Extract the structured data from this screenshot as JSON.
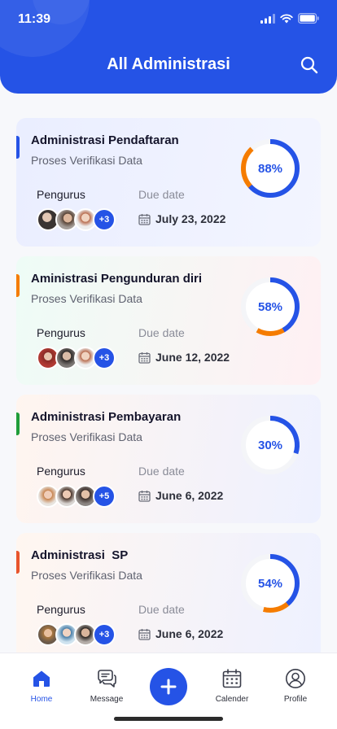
{
  "status_bar": {
    "time": "11:39"
  },
  "header": {
    "title": "All Administrasi"
  },
  "labels": {
    "pengurus": "Pengurus",
    "due_date": "Due date"
  },
  "colors": {
    "primary": "#2553e6",
    "ring_track": "#f4f5f8"
  },
  "cards": [
    {
      "title": "Administrasi Pendaftaran",
      "subtitle": "Proses Verifikasi Data",
      "extra": "+3",
      "due": "July 23, 2022",
      "percent": 88,
      "percent_label": "88%",
      "accent": "#2553e6",
      "secondary": "#f57c00",
      "bg_from": "#eaeeff",
      "bg_to": "#f3f5ff"
    },
    {
      "title": "Aministrasi Pengunduran diri",
      "subtitle": "Proses Verifikasi Data",
      "extra": "+3",
      "due": "June 12, 2022",
      "percent": 58,
      "percent_label": "58%",
      "accent": "#f57c00",
      "secondary": "#f57c00",
      "bg_from": "#eefcf6",
      "bg_to": "#fff0f3"
    },
    {
      "title": "Administrasi Pembayaran",
      "subtitle": "Proses Verifikasi Data",
      "extra": "+5",
      "due": "June 6, 2022",
      "percent": 30,
      "percent_label": "30%",
      "accent": "#1f9d3a",
      "secondary": "#1f9d3a",
      "bg_from": "#fff5ef",
      "bg_to": "#eef1ff"
    },
    {
      "title": "Administrasi  SP",
      "subtitle": "Proses Verifikasi Data",
      "extra": "+3",
      "due": "June 6, 2022",
      "percent": 54,
      "percent_label": "54%",
      "accent": "#e8552d",
      "secondary": "#f57c00",
      "bg_from": "#fff6f0",
      "bg_to": "#eef1ff"
    }
  ],
  "nav": [
    {
      "label": "Home",
      "icon": "home-icon"
    },
    {
      "label": "Message",
      "icon": "chat-icon"
    },
    {
      "label": "Calender",
      "icon": "calendar-icon"
    },
    {
      "label": "Profile",
      "icon": "profile-icon"
    }
  ]
}
